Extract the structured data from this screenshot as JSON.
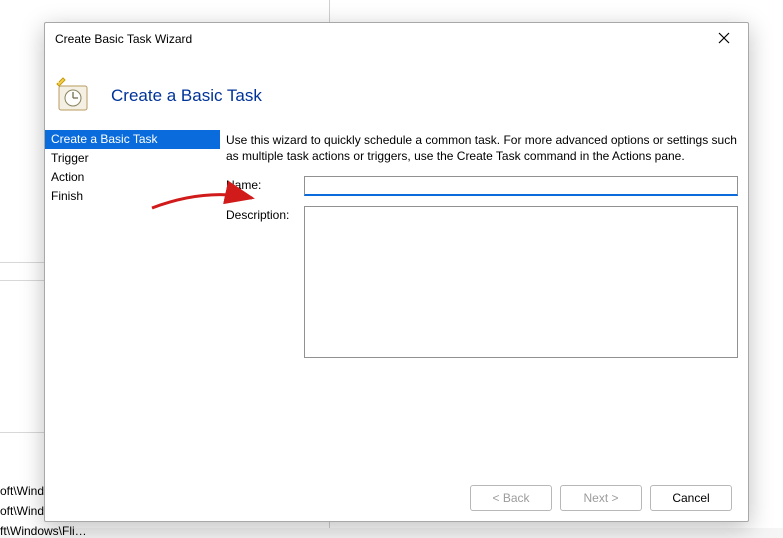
{
  "background": {
    "tree_item_1": "oft\\Wind…",
    "tree_item_2": "oft\\Windows\\U…",
    "tree_item_3": "ft\\Windows\\Fli…"
  },
  "dialog": {
    "title": "Create Basic Task Wizard",
    "heading": "Create a Basic Task",
    "nav": {
      "items": [
        {
          "label": "Create a Basic Task",
          "selected": true
        },
        {
          "label": "Trigger",
          "selected": false
        },
        {
          "label": "Action",
          "selected": false
        },
        {
          "label": "Finish",
          "selected": false
        }
      ]
    },
    "intro": "Use this wizard to quickly schedule a common task.  For more advanced options or settings such as multiple task actions or triggers, use the Create Task command in the Actions pane.",
    "name_label": "Name:",
    "name_value": "",
    "desc_label": "Description:",
    "desc_value": "",
    "buttons": {
      "back": "< Back",
      "next": "Next >",
      "cancel": "Cancel"
    }
  }
}
